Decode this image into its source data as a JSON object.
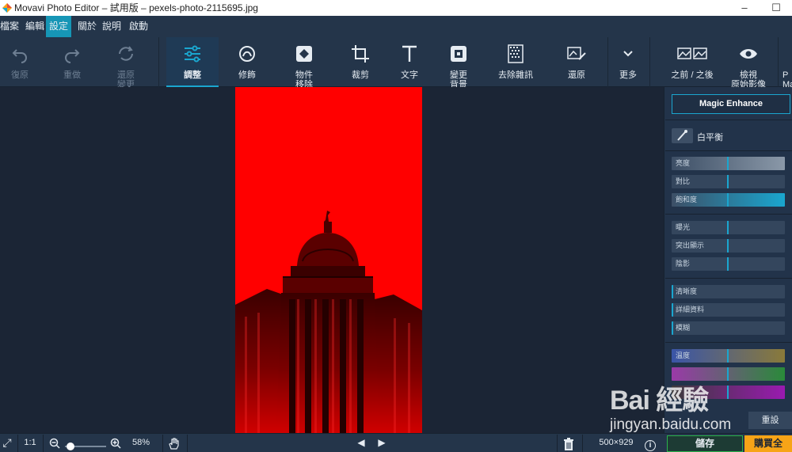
{
  "window": {
    "title": "Movavi Photo Editor – 試用版 – pexels-photo-2115695.jpg",
    "minimize": "–",
    "maximize": "☐"
  },
  "menu": [
    "檔案",
    "編輯",
    "設定",
    "關於",
    "說明",
    "啟動"
  ],
  "menu_active_index": 2,
  "toolbar": {
    "undo": "復原",
    "redo": "重做",
    "restore_adjust_line1": "還原",
    "restore_adjust_line2": "變更",
    "adjust": "調整",
    "retouch": "修飾",
    "object_remove_line1": "物件",
    "object_remove_line2": "移除",
    "crop": "裁剪",
    "text": "文字",
    "change_bg_line1": "變更",
    "change_bg_line2": "背景",
    "denoise": "去除雜訊",
    "restore": "還原",
    "more": "更多",
    "before_after": "之前 / 之後",
    "view_original_line1": "檢視",
    "view_original_line2": "原始影像",
    "partial_line1": "P",
    "partial_line2": "Ma"
  },
  "panel": {
    "magic_enhance": "Magic Enhance",
    "white_balance": "白平衡",
    "group1": [
      "亮度",
      "對比",
      "飽和度"
    ],
    "group2": [
      "曝光",
      "突出顯示",
      "陰影"
    ],
    "group3": [
      "清晰度",
      "詳細資料",
      "模糊"
    ],
    "group4": [
      "溫度"
    ],
    "reset": "重設"
  },
  "bottom": {
    "fit": "⤢",
    "one_to_one": "1:1",
    "zoom": "58%",
    "prev": "◀",
    "next": "▶",
    "dimensions": "500×929",
    "info": "i",
    "save": "儲存",
    "buy": "購買全"
  },
  "watermark": {
    "line1": "Bai 經驗",
    "line2": "jingyan.baidu.com"
  },
  "colors": {
    "accent": "#1aa6cf",
    "photo_red": "#ff0000",
    "save_green": "#2bb24c",
    "buy_orange": "#f7a417"
  }
}
